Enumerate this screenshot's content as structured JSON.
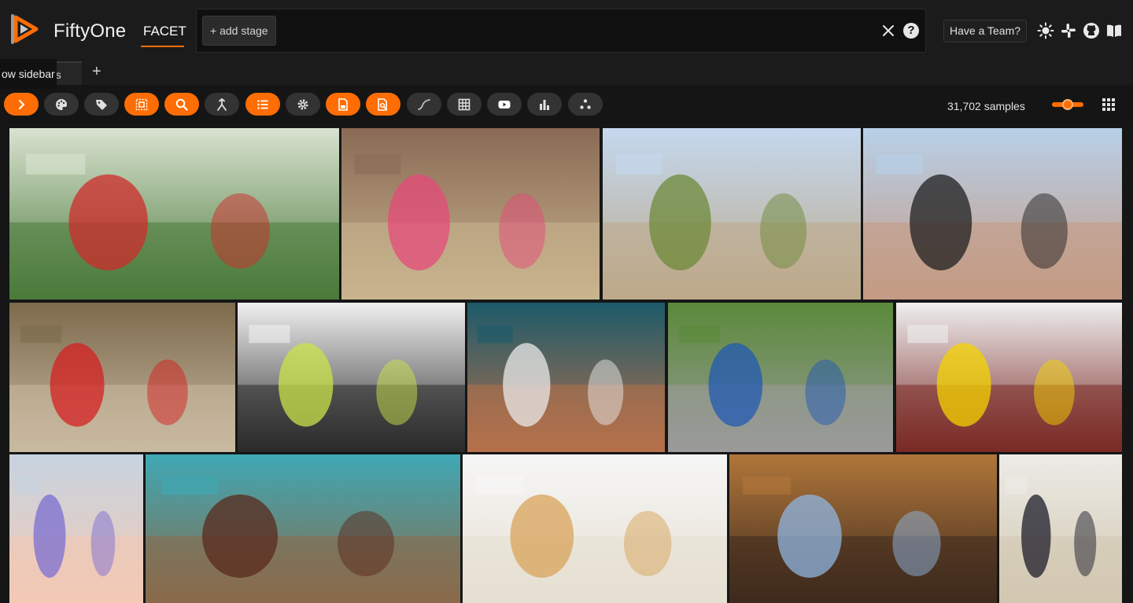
{
  "app": {
    "brand": "FiftyOne",
    "dataset_tab": "FACET",
    "add_stage": "+ add stage",
    "help": "?",
    "team_button": "Have a Team?"
  },
  "tabs": {
    "tooltip": "ow sidebar",
    "tab_rest": "es",
    "add_tab": "+"
  },
  "toolbar": {
    "sample_count": "31,702 samples",
    "zoom_level": 0.5,
    "buttons": [
      {
        "icon": "chevron-right-icon",
        "active": true
      },
      {
        "icon": "palette-icon",
        "active": false
      },
      {
        "icon": "tag-icon",
        "active": false
      },
      {
        "icon": "select-icon",
        "active": true
      },
      {
        "icon": "search-icon",
        "active": true
      },
      {
        "icon": "merge-icon",
        "active": false
      },
      {
        "icon": "list-icon",
        "active": true
      },
      {
        "icon": "gear-icon",
        "active": false
      },
      {
        "icon": "document-icon",
        "active": true
      },
      {
        "icon": "document-search-icon",
        "active": true
      },
      {
        "icon": "curve-icon",
        "active": false
      },
      {
        "icon": "table-icon",
        "active": false
      },
      {
        "icon": "video-icon",
        "active": false
      },
      {
        "icon": "bar-chart-icon",
        "active": false
      },
      {
        "icon": "embeddings-icon",
        "active": false
      }
    ]
  },
  "colors": {
    "accent": "#ff6d04",
    "background": "#151515",
    "header": "#1b1b1b"
  },
  "grid": {
    "images": [
      {
        "name": "protest-riot-police",
        "sky": "#d9e2d0",
        "ground": "#4a7a3a",
        "accent": "#cf2b2b"
      },
      {
        "name": "woman-in-flower-garden",
        "sky": "#8a6a55",
        "ground": "#c9b48e",
        "accent": "#e64a7a"
      },
      {
        "name": "desert-dirt-trail",
        "sky": "#c4d8ef",
        "ground": "#bda98a",
        "accent": "#6e8a3a"
      },
      {
        "name": "two-police-officers-square",
        "sky": "#b8d0e8",
        "ground": "#c49a84",
        "accent": "#1f1f1f"
      },
      {
        "name": "construction-site-danger-sign",
        "sky": "#7d6a4d",
        "ground": "#c8b9a0",
        "accent": "#d42020"
      },
      {
        "name": "hands-typing-on-laptop",
        "sky": "#f0f0f0",
        "ground": "#2a2a2a",
        "accent": "#c9e34a"
      },
      {
        "name": "baseball-batter-swinging",
        "sky": "#1d5a6a",
        "ground": "#b7714a",
        "accent": "#e9e9e9"
      },
      {
        "name": "police-motorcycle-street",
        "sky": "#5a8a3a",
        "ground": "#9a9a9a",
        "accent": "#2259b3"
      },
      {
        "name": "race-car-in-garage",
        "sky": "#efefef",
        "ground": "#7a2a25",
        "accent": "#f4d300"
      },
      {
        "name": "dental-syringe-mouth",
        "sky": "#c7d3e0",
        "ground": "#f3c9b4",
        "accent": "#7b6ed1"
      },
      {
        "name": "woman-with-clay-pots",
        "sky": "#3fa8b5",
        "ground": "#8a6a4a",
        "accent": "#5a2a1e"
      },
      {
        "name": "double-exposure-figures",
        "sky": "#f6f6f6",
        "ground": "#e6e0d2",
        "accent": "#d8a35a"
      },
      {
        "name": "singer-at-microphone",
        "sky": "#b0763a",
        "ground": "#3e2a1e",
        "accent": "#8fb6e0"
      },
      {
        "name": "honor-guard-flags",
        "sky": "#ecebe6",
        "ground": "#d2c7b0",
        "accent": "#1c1c2a"
      }
    ]
  }
}
